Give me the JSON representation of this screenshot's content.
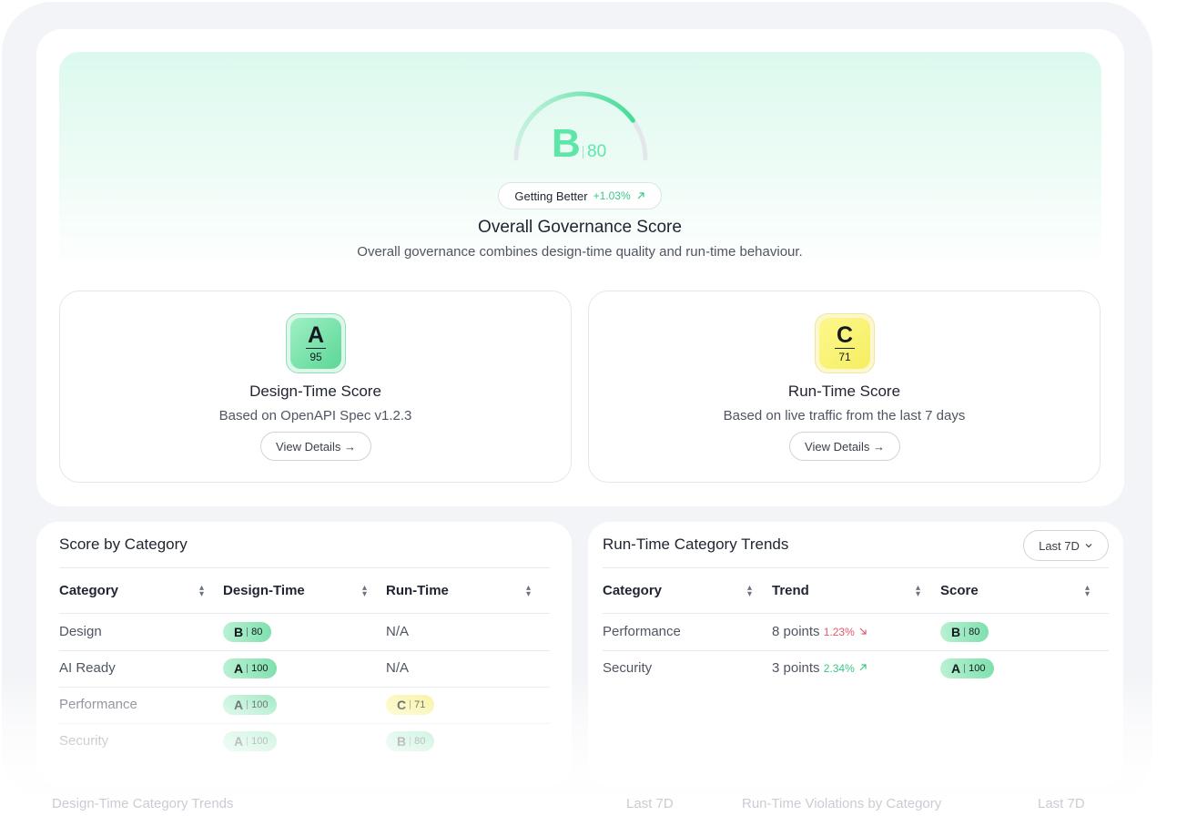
{
  "overall": {
    "grade": "B",
    "score": "80",
    "progress": 0.8,
    "trend_label": "Getting Better",
    "trend_value": "+1.03%",
    "trend_icon": "arrow-up-right-icon",
    "title": "Overall Governance Score",
    "subtitle": "Overall governance combines design-time quality and run-time behaviour."
  },
  "design_time": {
    "grade": "A",
    "score": "95",
    "title": "Design-Time Score",
    "subtitle": "Based on OpenAPI Spec v1.2.3",
    "button": "View Details →"
  },
  "run_time": {
    "grade": "C",
    "score": "71",
    "title": "Run-Time Score",
    "subtitle": "Based on live traffic from the last 7 days",
    "button": "View Details →"
  },
  "score_by_category": {
    "title": "Score by Category",
    "columns": [
      "Category",
      "Design-Time",
      "Run-Time"
    ],
    "rows": [
      {
        "category": "Design",
        "design_grade": "B",
        "design_score": "80",
        "run_time": "N/A"
      },
      {
        "category": "AI Ready",
        "design_grade": "A",
        "design_score": "100",
        "run_time": "N/A"
      },
      {
        "category": "Performance",
        "design_grade": "A",
        "design_score": "100",
        "run_grade": "C",
        "run_score": "71"
      },
      {
        "category": "Security",
        "design_grade": "A",
        "design_score": "100",
        "run_grade": "B",
        "run_score": "80"
      }
    ]
  },
  "runtime_trends": {
    "title": "Run-Time Category Trends",
    "range": "Last 7D",
    "columns": [
      "Category",
      "Trend",
      "Score"
    ],
    "rows": [
      {
        "category": "Performance",
        "points": "8 points",
        "pct": "1.23%",
        "direction": "down",
        "grade": "B",
        "score": "80"
      },
      {
        "category": "Security",
        "points": "3 points",
        "pct": "2.34%",
        "direction": "up",
        "grade": "A",
        "score": "100"
      }
    ]
  },
  "below_fold": {
    "left_title": "Design-Time Category Trends",
    "left_range": "Last 7D",
    "right_title": "Run-Time Violations by Category",
    "right_range": "Last 7D"
  },
  "colors": {
    "accent_green": "#5ee6a8",
    "trend_up": "#39c886",
    "trend_down": "#e0596c",
    "grade_c": "#f5ee60"
  }
}
